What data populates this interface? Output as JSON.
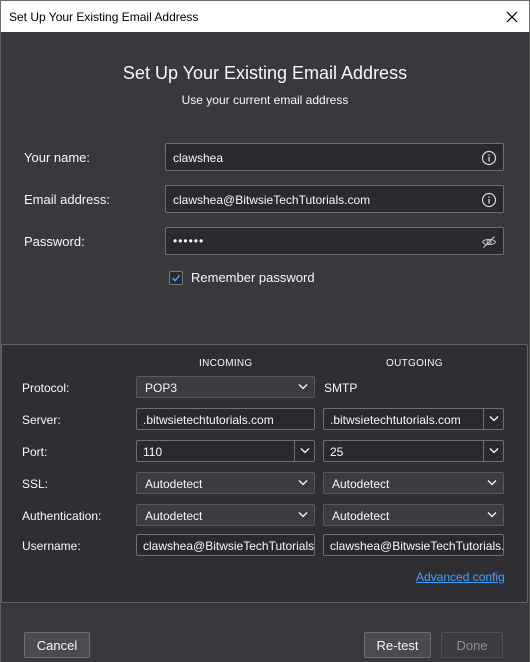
{
  "window": {
    "title": "Set Up Your Existing Email Address"
  },
  "header": {
    "title": "Set Up Your Existing Email Address",
    "subtitle": "Use your current email address"
  },
  "form": {
    "name_label": "Your name:",
    "name_value": "clawshea",
    "email_label": "Email address:",
    "email_value": "clawshea@BitwsieTechTutorials.com",
    "password_label": "Password:",
    "password_value": "••••••",
    "remember_label": "Remember password",
    "remember_checked": true
  },
  "config": {
    "incoming_header": "INCOMING",
    "outgoing_header": "OUTGOING",
    "protocol_label": "Protocol:",
    "protocol_incoming": "POP3",
    "protocol_outgoing": "SMTP",
    "server_label": "Server:",
    "server_incoming": ".bitwsietechtutorials.com",
    "server_outgoing": ".bitwsietechtutorials.com",
    "port_label": "Port:",
    "port_incoming": "110",
    "port_outgoing": "25",
    "ssl_label": "SSL:",
    "ssl_incoming": "Autodetect",
    "ssl_outgoing": "Autodetect",
    "auth_label": "Authentication:",
    "auth_incoming": "Autodetect",
    "auth_outgoing": "Autodetect",
    "username_label": "Username:",
    "username_incoming": "clawshea@BitwsieTechTutorials.c",
    "username_outgoing": "clawshea@BitwsieTechTutorials.c",
    "advanced_link": "Advanced config"
  },
  "buttons": {
    "cancel": "Cancel",
    "retest": "Re-test",
    "done": "Done"
  },
  "colors": {
    "background": "#38383d",
    "panel": "#2f2f33",
    "link": "#45a1ff",
    "checkbox_accent": "#0a84ff"
  },
  "icons": {
    "close": "close-icon",
    "info": "info-icon",
    "eye": "eye-slash-icon",
    "check": "check-icon",
    "chevron": "chevron-down-icon"
  }
}
